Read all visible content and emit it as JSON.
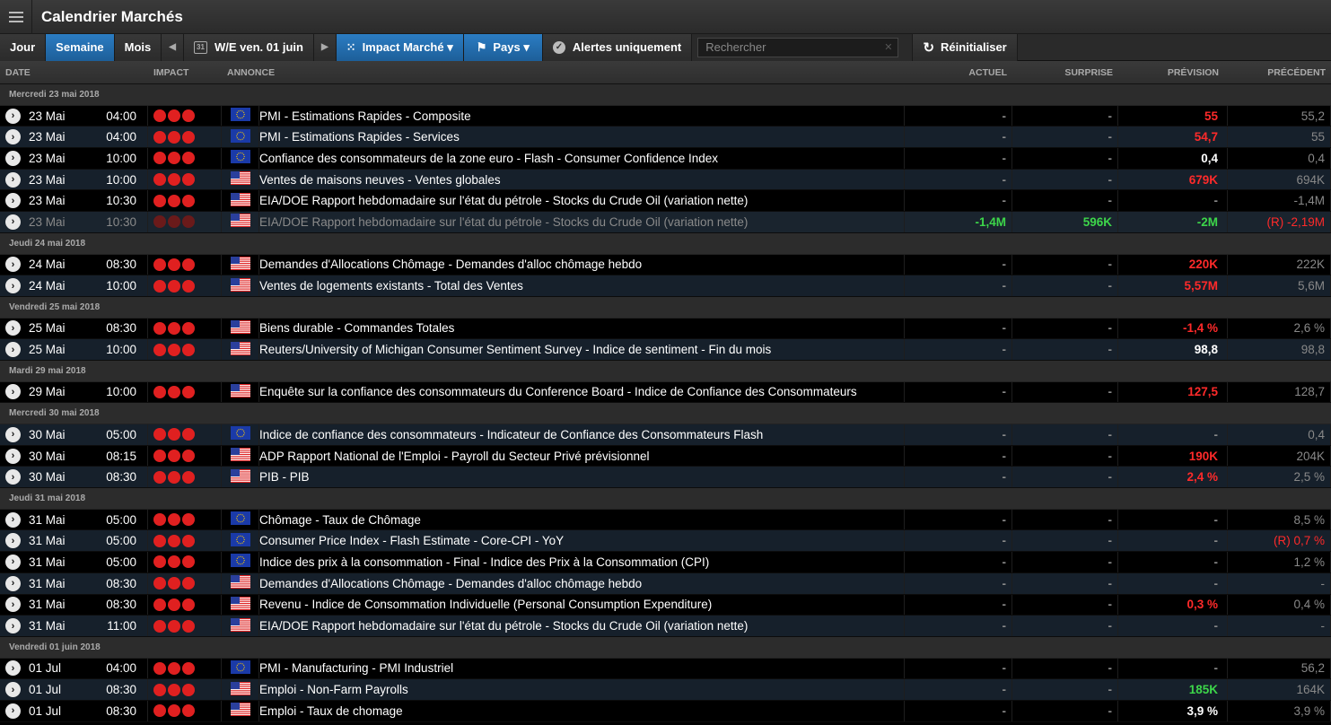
{
  "app": {
    "title": "Calendrier Marchés"
  },
  "toolbar": {
    "jour": "Jour",
    "semaine": "Semaine",
    "mois": "Mois",
    "prev": "◀",
    "calendar_day": "31",
    "period": "W/E ven. 01 juin",
    "next": "▶",
    "impact": "Impact Marché ▾",
    "pays": "Pays ▾",
    "alertes": "Alertes uniquement",
    "search_placeholder": "Rechercher",
    "reset": "Réinitialiser"
  },
  "columns": {
    "date": "DATE",
    "impact": "IMPACT",
    "annonce": "ANNONCE",
    "actuel": "ACTUEL",
    "surprise": "SURPRISE",
    "prevision": "PRÉVISION",
    "precedent": "PRÉCÉDENT"
  },
  "colors": {
    "accent": "#2b7dc3",
    "negative": "#ff2a2a",
    "positive": "#3dd64a"
  },
  "groups": [
    {
      "label": "Mercredi 23 mai 2018",
      "rows": [
        {
          "d": "23 Mai",
          "t": "04:00",
          "flag": "eu",
          "ann": "PMI - Estimations Rapides - Composite",
          "act": "-",
          "sur": "-",
          "prev": "55",
          "prevc": "red",
          "prec": "55,2",
          "precc": "muted"
        },
        {
          "d": "23 Mai",
          "t": "04:00",
          "flag": "eu",
          "ann": "PMI - Estimations Rapides - Services",
          "act": "-",
          "sur": "-",
          "prev": "54,7",
          "prevc": "red",
          "prec": "55",
          "precc": "muted"
        },
        {
          "d": "23 Mai",
          "t": "10:00",
          "flag": "eu",
          "ann": "Confiance des consommateurs de la zone euro - Flash - Consumer Confidence Index",
          "act": "-",
          "sur": "-",
          "prev": "0,4",
          "prevc": "",
          "prec": "0,4",
          "precc": "muted"
        },
        {
          "d": "23 Mai",
          "t": "10:00",
          "flag": "us",
          "ann": "Ventes de maisons neuves - Ventes globales",
          "act": "-",
          "sur": "-",
          "prev": "679K",
          "prevc": "red",
          "prec": "694K",
          "precc": "muted"
        },
        {
          "d": "23 Mai",
          "t": "10:30",
          "flag": "us",
          "ann": "EIA/DOE Rapport hebdomadaire sur l'état du pétrole - Stocks du Crude Oil (variation nette)",
          "act": "-",
          "sur": "-",
          "prev": "-",
          "prevc": "muted",
          "prec": "-1,4M",
          "precc": "muted"
        },
        {
          "d": "23 Mai",
          "t": "10:30",
          "flag": "us",
          "ann": "EIA/DOE Rapport hebdomadaire sur l'état du pétrole - Stocks du Crude Oil (variation nette)",
          "act": "-1,4M",
          "actc": "green",
          "sur": "596K",
          "surc": "green",
          "prev": "-2M",
          "prevc": "green",
          "prec": "(R) -2,19M",
          "precc": "red",
          "dim": true
        }
      ]
    },
    {
      "label": "Jeudi 24 mai 2018",
      "rows": [
        {
          "d": "24 Mai",
          "t": "08:30",
          "flag": "us",
          "ann": "Demandes d'Allocations Chômage - Demandes d'alloc chômage hebdo",
          "act": "-",
          "sur": "-",
          "prev": "220K",
          "prevc": "red",
          "prec": "222K",
          "precc": "muted"
        },
        {
          "d": "24 Mai",
          "t": "10:00",
          "flag": "us",
          "ann": "Ventes de logements existants - Total des Ventes",
          "act": "-",
          "sur": "-",
          "prev": "5,57M",
          "prevc": "red",
          "prec": "5,6M",
          "precc": "muted"
        }
      ]
    },
    {
      "label": "Vendredi 25 mai 2018",
      "rows": [
        {
          "d": "25 Mai",
          "t": "08:30",
          "flag": "us",
          "ann": "Biens durable - Commandes Totales",
          "act": "-",
          "sur": "-",
          "prev": "-1,4 %",
          "prevc": "red",
          "prec": "2,6 %",
          "precc": "muted"
        },
        {
          "d": "25 Mai",
          "t": "10:00",
          "flag": "us",
          "ann": "Reuters/University of Michigan Consumer Sentiment Survey - Indice de sentiment - Fin du mois",
          "act": "-",
          "sur": "-",
          "prev": "98,8",
          "prevc": "",
          "prec": "98,8",
          "precc": "muted"
        }
      ]
    },
    {
      "label": "Mardi 29 mai 2018",
      "rows": [
        {
          "d": "29 Mai",
          "t": "10:00",
          "flag": "us",
          "ann": "Enquête sur la confiance des consommateurs du Conference Board - Indice de Confiance des Consommateurs",
          "act": "-",
          "sur": "-",
          "prev": "127,5",
          "prevc": "red",
          "prec": "128,7",
          "precc": "muted"
        }
      ]
    },
    {
      "label": "Mercredi 30 mai 2018",
      "rows": [
        {
          "d": "30 Mai",
          "t": "05:00",
          "flag": "eu",
          "ann": "Indice de confiance des consommateurs - Indicateur de Confiance des Consommateurs Flash",
          "act": "-",
          "sur": "-",
          "prev": "-",
          "prevc": "muted",
          "prec": "0,4",
          "precc": "muted"
        },
        {
          "d": "30 Mai",
          "t": "08:15",
          "flag": "us",
          "ann": "ADP Rapport National de l'Emploi - Payroll du Secteur Privé prévisionnel",
          "act": "-",
          "sur": "-",
          "prev": "190K",
          "prevc": "red",
          "prec": "204K",
          "precc": "muted"
        },
        {
          "d": "30 Mai",
          "t": "08:30",
          "flag": "us",
          "ann": "PIB - PIB",
          "act": "-",
          "sur": "-",
          "prev": "2,4 %",
          "prevc": "red",
          "prec": "2,5 %",
          "precc": "muted"
        }
      ]
    },
    {
      "label": "Jeudi 31 mai 2018",
      "rows": [
        {
          "d": "31 Mai",
          "t": "05:00",
          "flag": "eu",
          "ann": "Chômage - Taux de Chômage",
          "act": "-",
          "sur": "-",
          "prev": "-",
          "prevc": "muted",
          "prec": "8,5 %",
          "precc": "muted"
        },
        {
          "d": "31 Mai",
          "t": "05:00",
          "flag": "eu",
          "ann": "Consumer Price Index - Flash Estimate - Core-CPI - YoY",
          "act": "-",
          "sur": "-",
          "prev": "-",
          "prevc": "muted",
          "prec": "(R) 0,7 %",
          "precc": "red"
        },
        {
          "d": "31 Mai",
          "t": "05:00",
          "flag": "eu",
          "ann": "Indice des prix à la consommation - Final - Indice des Prix à la Consommation (CPI)",
          "act": "-",
          "sur": "-",
          "prev": "-",
          "prevc": "muted",
          "prec": "1,2 %",
          "precc": "muted"
        },
        {
          "d": "31 Mai",
          "t": "08:30",
          "flag": "us",
          "ann": "Demandes d'Allocations Chômage - Demandes d'alloc chômage hebdo",
          "act": "-",
          "sur": "-",
          "prev": "-",
          "prevc": "muted",
          "prec": "-",
          "precc": "muted"
        },
        {
          "d": "31 Mai",
          "t": "08:30",
          "flag": "us",
          "ann": "Revenu - Indice de Consommation Individuelle (Personal Consumption Expenditure)",
          "act": "-",
          "sur": "-",
          "prev": "0,3 %",
          "prevc": "red",
          "prec": "0,4 %",
          "precc": "muted"
        },
        {
          "d": "31 Mai",
          "t": "11:00",
          "flag": "us",
          "ann": "EIA/DOE Rapport hebdomadaire sur l'état du pétrole - Stocks du Crude Oil (variation nette)",
          "act": "-",
          "sur": "-",
          "prev": "-",
          "prevc": "muted",
          "prec": "-",
          "precc": "muted"
        }
      ]
    },
    {
      "label": "Vendredi 01 juin 2018",
      "rows": [
        {
          "d": "01 Jul",
          "t": "04:00",
          "flag": "eu",
          "ann": "PMI - Manufacturing - PMI Industriel",
          "act": "-",
          "sur": "-",
          "prev": "-",
          "prevc": "muted",
          "prec": "56,2",
          "precc": "muted"
        },
        {
          "d": "01 Jul",
          "t": "08:30",
          "flag": "us",
          "ann": "Emploi - Non-Farm Payrolls",
          "act": "-",
          "sur": "-",
          "prev": "185K",
          "prevc": "green",
          "prec": "164K",
          "precc": "muted"
        },
        {
          "d": "01 Jul",
          "t": "08:30",
          "flag": "us",
          "ann": "Emploi - Taux de chomage",
          "act": "-",
          "sur": "-",
          "prev": "3,9 %",
          "prevc": "",
          "prec": "3,9 %",
          "precc": "muted"
        }
      ]
    }
  ]
}
